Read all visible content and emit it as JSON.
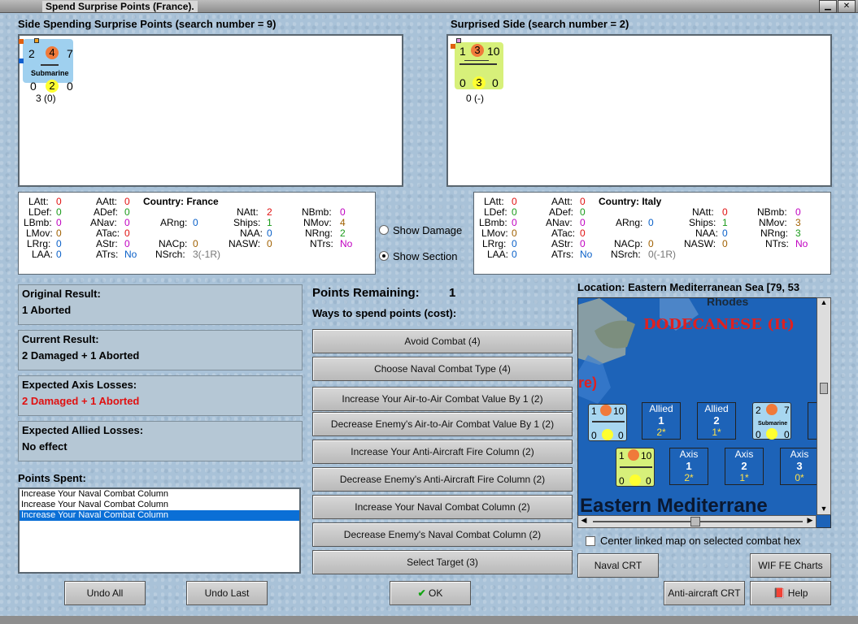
{
  "window": {
    "title": "Spend Surprise Points (France)."
  },
  "left_panel": {
    "label": "Side Spending Surprise Points (search number = 9)",
    "counter": {
      "top": [
        "2",
        "4",
        "7"
      ],
      "name": "Submarine",
      "bottom": [
        "0",
        "2",
        "0"
      ],
      "caption": "3 (0)"
    }
  },
  "right_panel": {
    "label": "Surprised Side (search number = 2)",
    "counter": {
      "top": [
        "1",
        "3",
        "10"
      ],
      "bottom": [
        "0",
        "3",
        "0"
      ],
      "caption": "0 (-)"
    }
  },
  "stats_left": {
    "country_label": "Country: France",
    "rows": [
      [
        "LAtt:",
        "0",
        "AAtt:",
        "0",
        "",
        "",
        "NAtt:",
        "2",
        "NBmb:",
        "0"
      ],
      [
        "LDef:",
        "0",
        "ADef:",
        "0",
        "",
        "",
        "",
        "",
        "",
        ""
      ],
      [
        "LBmb:",
        "0",
        "ANav:",
        "0",
        "ARng:",
        "0",
        "Ships:",
        "1",
        "NMov:",
        "4"
      ],
      [
        "LMov:",
        "0",
        "ATac:",
        "0",
        "",
        "",
        "NAA:",
        "0",
        "NRng:",
        "2"
      ],
      [
        "LRrg:",
        "0",
        "AStr:",
        "0",
        "NACp:",
        "0",
        "NASW:",
        "0",
        "NTrs:",
        "No"
      ],
      [
        "LAA:",
        "0",
        "ATrs:",
        "No",
        "NSrch:",
        "3(-1R)",
        "",
        "",
        "",
        ""
      ]
    ]
  },
  "stats_right": {
    "country_label": "Country: Italy",
    "rows": [
      [
        "LAtt:",
        "0",
        "AAtt:",
        "0",
        "",
        "",
        "NAtt:",
        "0",
        "NBmb:",
        "0"
      ],
      [
        "LDef:",
        "0",
        "ADef:",
        "0",
        "",
        "",
        "",
        "",
        "",
        ""
      ],
      [
        "LBmb:",
        "0",
        "ANav:",
        "0",
        "ARng:",
        "0",
        "Ships:",
        "1",
        "NMov:",
        "3"
      ],
      [
        "LMov:",
        "0",
        "ATac:",
        "0",
        "",
        "",
        "NAA:",
        "0",
        "NRng:",
        "3"
      ],
      [
        "LRrg:",
        "0",
        "AStr:",
        "0",
        "NACp:",
        "0",
        "NASW:",
        "0",
        "NTrs:",
        "No"
      ],
      [
        "LAA:",
        "0",
        "ATrs:",
        "No",
        "NSrch:",
        "0(-1R)",
        "",
        "",
        "",
        ""
      ]
    ]
  },
  "view_options": {
    "show_damage": "Show Damage",
    "show_section": "Show Section",
    "selected": "show_section"
  },
  "results": {
    "original_label": "Original Result:",
    "original_value": "1 Aborted",
    "current_label": "Current Result:",
    "current_value": "2 Damaged + 1 Aborted",
    "axis_label": "Expected Axis Losses:",
    "axis_value": "2 Damaged + 1 Aborted",
    "allied_label": "Expected Allied Losses:",
    "allied_value": "No effect",
    "points_spent_label": "Points Spent:"
  },
  "points_spent": [
    "Increase Your Naval Combat Column",
    "Increase Your Naval Combat Column",
    "Increase Your Naval Combat Column"
  ],
  "points": {
    "remaining_label": "Points Remaining:",
    "remaining_value": "1",
    "ways_label": "Ways to spend points (cost):"
  },
  "actions": [
    "Avoid Combat (4)",
    "Choose Naval Combat Type (4)",
    "Increase Your Air-to-Air Combat Value By 1 (2)",
    "Decrease Enemy's Air-to-Air Combat Value By 1 (2)",
    "Increase Your Anti-Aircraft Fire Column (2)",
    "Decrease Enemy's Anti-Aircraft Fire Column (2)",
    "Increase Your Naval Combat Column (2)",
    "Decrease Enemy's Naval Combat Column (2)",
    "Select Target (3)"
  ],
  "map": {
    "location": "Location: Eastern Mediterranean Sea [79, 53",
    "labels": [
      "Rhodes",
      "DODECANESE (It)",
      "re)",
      "Eastern Mediterrane"
    ],
    "allied_boxes": [
      {
        "title": "Allied",
        "num": "1",
        "val": "2*"
      },
      {
        "title": "Allied",
        "num": "2",
        "val": "1*"
      }
    ],
    "axis_boxes": [
      {
        "title": "Axis",
        "num": "1",
        "val": "2*"
      },
      {
        "title": "Axis",
        "num": "2",
        "val": "1*"
      },
      {
        "title": "Axis",
        "num": "3",
        "val": "0*"
      }
    ],
    "center_checkbox": "Center linked map on selected combat hex"
  },
  "buttons": {
    "undo_all": "Undo All",
    "undo_last": "Undo Last",
    "ok": "OK",
    "naval_crt": "Naval CRT",
    "wif_fe_charts": "WIF FE Charts",
    "anti_aircraft_crt": "Anti-aircraft CRT",
    "help": "Help"
  }
}
